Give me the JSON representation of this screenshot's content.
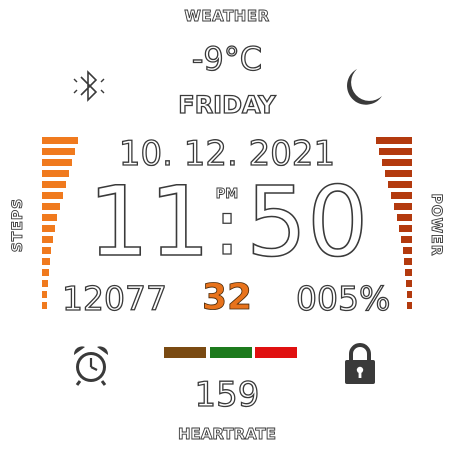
{
  "weather": {
    "label": "WEATHER",
    "temperature": "-9°C"
  },
  "day": "FRIDAY",
  "date": "10. 12. 2021",
  "time": {
    "hours": "11",
    "minutes": "50",
    "ampm": "PM",
    "separator": ":"
  },
  "steps": {
    "label": "STEPS",
    "value": "12077",
    "level": 1.0
  },
  "power": {
    "label": "POWER",
    "value": "005%",
    "level": 1.0
  },
  "center_value": "32",
  "heart": {
    "label": "HEARTRATE",
    "value": "159"
  },
  "icons": {
    "top_left": "bluetooth-icon",
    "top_right": "moon-icon",
    "bottom_left": "alarm-clock-icon",
    "bottom_right": "lock-icon"
  },
  "colors": {
    "steps_bar": "#f07a1e",
    "power_bar": "#b33a0e",
    "center_value": "#e8731c",
    "status_brown": "#7a4a12",
    "status_green": "#1d7a1d",
    "status_red": "#e01010"
  }
}
